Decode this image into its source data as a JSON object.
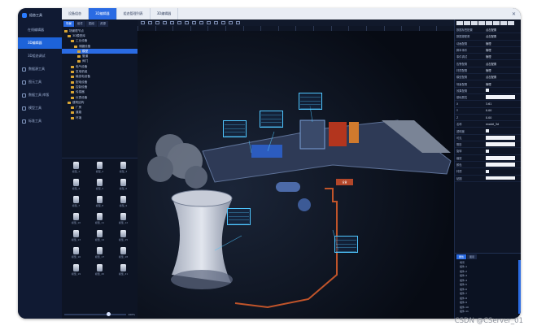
{
  "left_nav": {
    "items": [
      {
        "label": "组态工具",
        "active": false
      },
      {
        "label": "在线编辑器",
        "active": false
      },
      {
        "label": "3D编辑器",
        "active": true
      },
      {
        "label": "3D组态调试",
        "active": false
      },
      {
        "label": "数据源工具",
        "active": false
      },
      {
        "label": "图元工具",
        "active": false
      },
      {
        "label": "数据工具 库版",
        "active": false
      },
      {
        "label": "模型工具",
        "active": false
      },
      {
        "label": "标准工具",
        "active": false
      }
    ]
  },
  "tabs": [
    {
      "label": "设备组态"
    },
    {
      "label": "3D编辑器",
      "active": true
    },
    {
      "label": "组态管理列表"
    },
    {
      "label": "3D编辑器"
    }
  ],
  "tree": {
    "tabs": [
      "场景",
      "组件",
      "图纸",
      "资源"
    ],
    "nodes": [
      "场景根节点",
      "3D模型库",
      "工业设备",
      "储罐设备",
      "模型",
      "管道",
      "阀门",
      "电气设备",
      "发电机组",
      "输变电设备",
      "配电设备",
      "控制设备",
      "传感器",
      "仪表设备",
      "建筑结构",
      "厂房",
      "道路",
      "环境"
    ]
  },
  "palette": {
    "items": [
      "模型_1",
      "模型_2",
      "模型_3",
      "模型_4",
      "模型_5",
      "模型_6",
      "模型_7",
      "模型_8",
      "模型_9",
      "模型_10",
      "模型_11",
      "模型_12",
      "模型_13",
      "模型_14",
      "模型_15",
      "模型_16",
      "模型_17",
      "模型_18",
      "模型_19",
      "模型_20",
      "模型_21"
    ],
    "zoom_label": "100%"
  },
  "props": {
    "rows": [
      {
        "k": "数据标签配置",
        "v": "点击配置"
      },
      {
        "k": "数据源配置",
        "v": "点击配置"
      },
      {
        "k": "动画配置",
        "v": "管理"
      },
      {
        "k": "脚本事件",
        "v": "管理"
      },
      {
        "k": "事件调试",
        "v": "管理"
      },
      {
        "k": "告警配置",
        "v": "点击配置"
      },
      {
        "k": "材质配置",
        "v": "管理"
      },
      {
        "k": "模型配置",
        "v": "点击配置"
      },
      {
        "k": "场景配置",
        "v": "管理"
      },
      {
        "k": "效果配置",
        "v": ""
      },
      {
        "k": "基础属性",
        "v": ""
      },
      {
        "k": "X",
        "v": "3.61"
      },
      {
        "k": "Y",
        "v": "0.00"
      },
      {
        "k": "Z",
        "v": "0.00"
      },
      {
        "k": "名称",
        "v": "model_3d"
      },
      {
        "k": "透明度",
        "v": ""
      },
      {
        "k": "可见",
        "v": ""
      },
      {
        "k": "阴影",
        "v": ""
      },
      {
        "k": "旋转",
        "v": ""
      },
      {
        "k": "缩放",
        "v": ""
      },
      {
        "k": "颜色",
        "v": ""
      },
      {
        "k": "材质",
        "v": ""
      },
      {
        "k": "贴图",
        "v": ""
      }
    ],
    "tree_tabs": [
      "属性",
      "图层"
    ],
    "tree_nodes": [
      "场景",
      "组件-1",
      "组件-2",
      "组件-3",
      "组件-4",
      "组件-5",
      "组件-6",
      "组件-7",
      "组件-8",
      "组件-9",
      "组件-10",
      "组件-11"
    ]
  },
  "scene": {
    "tag_label": "设备"
  },
  "watermark": "CSDN @CServer_01"
}
